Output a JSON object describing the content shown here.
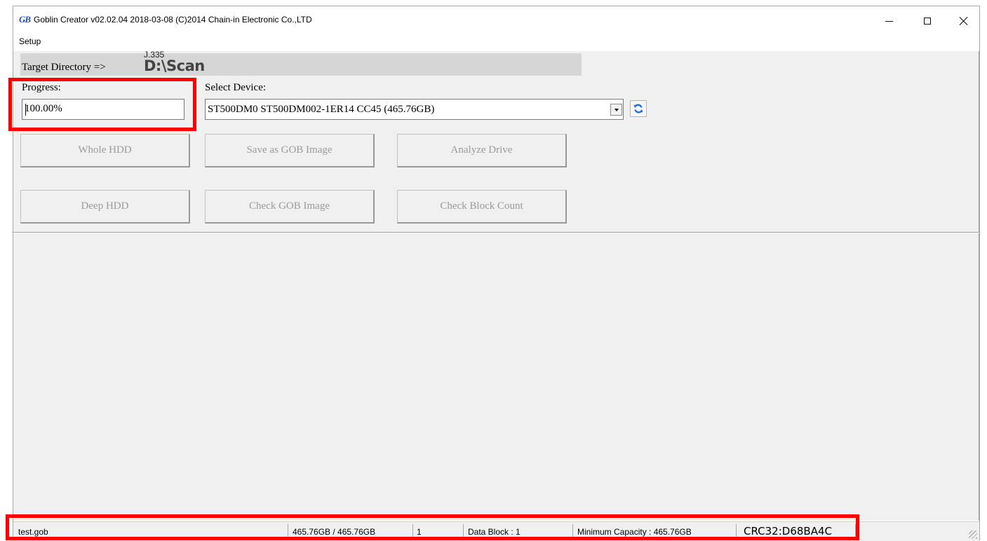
{
  "window": {
    "app_icon": "GB",
    "title": "Goblin Creator v02.02.04 2018-03-08  (C)2014 Chain-in Electronic Co.,LTD"
  },
  "menu": {
    "items": [
      "Setup"
    ]
  },
  "target": {
    "label": "Target Directory =>",
    "overlay_text": "J.335",
    "path": "D:\\Scan"
  },
  "progress": {
    "label": "Progress:",
    "value": "100.00%"
  },
  "device": {
    "label": "Select Device:",
    "selected": "ST500DM0 ST500DM002-1ER14 CC45 (465.76GB)",
    "refresh_icon": "refresh-icon"
  },
  "buttons": {
    "whole_hdd": "Whole HDD",
    "save_gob": "Save as GOB Image",
    "analyze": "Analyze Drive",
    "deep_hdd": "Deep HDD",
    "check_gob": "Check GOB Image",
    "check_block": "Check Block Count"
  },
  "status": {
    "file": "test.gob",
    "size": "465.76GB / 465.76GB",
    "count": "1",
    "data_block": "Data Block : 1",
    "min_capacity": "Minimum Capacity : 465.76GB",
    "crc": "CRC32:D68BA4C"
  },
  "colors": {
    "highlight": "#ff0000",
    "panel": "#f0f0f0",
    "disabled_text": "#9a9a9a",
    "icon_blue": "#1f6fd6"
  }
}
